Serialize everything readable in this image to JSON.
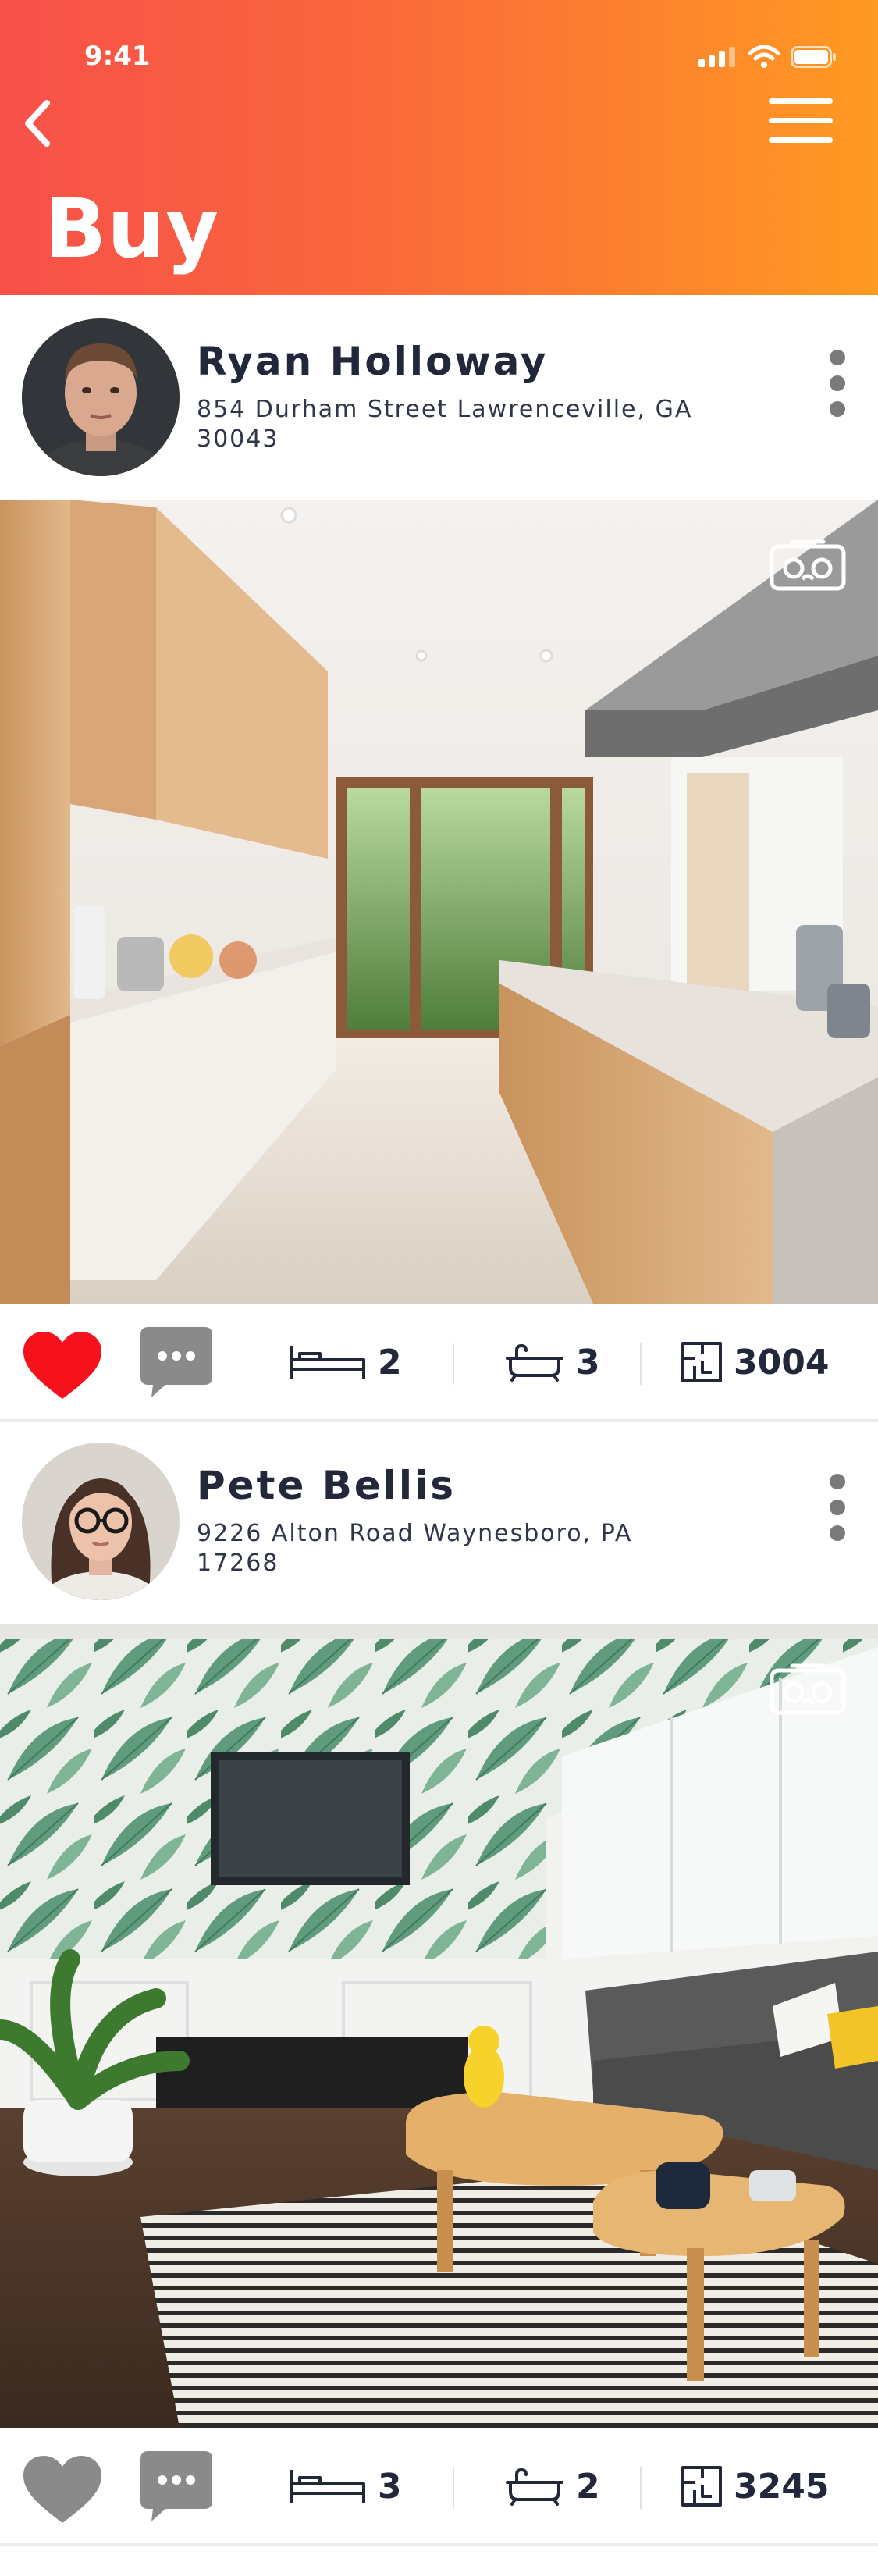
{
  "status_bar": {
    "time": "9:41"
  },
  "header": {
    "title": "Buy"
  },
  "listings": [
    {
      "name": "Ryan Holloway",
      "address": "854 Durham Street Lawrenceville, GA 30043",
      "liked": true,
      "beds": "2",
      "baths": "3",
      "area": "3004"
    },
    {
      "name": "Pete Bellis",
      "address": "9226 Alton Road Waynesboro, PA 17268",
      "liked": false,
      "beds": "3",
      "baths": "2",
      "area": "3245"
    }
  ],
  "colors": {
    "gradient_start": "#f7504a",
    "gradient_end": "#ff9a22",
    "like_active": "#f5121c",
    "like_inactive": "#8a8a8a",
    "text": "#22283a"
  },
  "icons": [
    "chevron-left-icon",
    "hamburger-menu-icon",
    "more-vertical-icon",
    "vr-headset-icon",
    "heart-icon",
    "comment-icon",
    "bed-icon",
    "bathtub-icon",
    "floor-plan-icon"
  ]
}
